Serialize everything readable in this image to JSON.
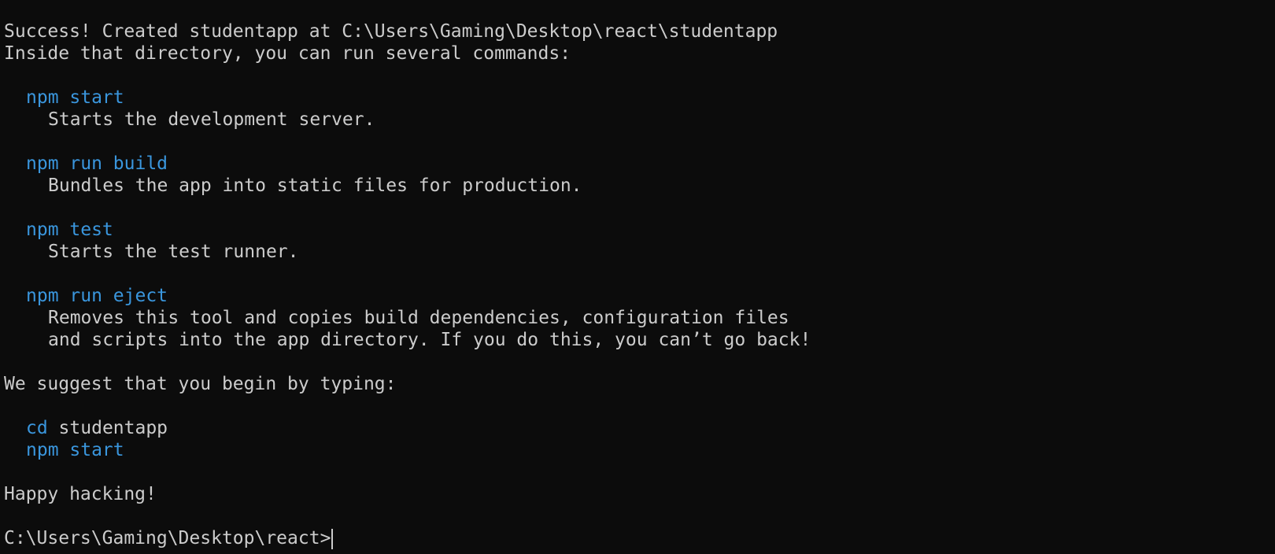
{
  "terminal": {
    "success_line": "Success! Created studentapp at C:\\Users\\Gaming\\Desktop\\react\\studentapp",
    "inside_line": "Inside that directory, you can run several commands:",
    "commands": [
      {
        "command": "npm start",
        "description": [
          "Starts the development server."
        ]
      },
      {
        "command": "npm run build",
        "description": [
          "Bundles the app into static files for production."
        ]
      },
      {
        "command": "npm test",
        "description": [
          "Starts the test runner."
        ]
      },
      {
        "command": "npm run eject",
        "description": [
          "Removes this tool and copies build dependencies, configuration files",
          "and scripts into the app directory. If you do this, you can’t go back!"
        ]
      }
    ],
    "suggest_line": "We suggest that you begin by typing:",
    "cd_keyword": "cd",
    "cd_arg": " studentapp",
    "start_command": "npm start",
    "happy_line": "Happy hacking!",
    "prompt": "C:\\Users\\Gaming\\Desktop\\react>"
  },
  "colors": {
    "background": "#0c0c0c",
    "text": "#cccccc",
    "command": "#3a96dd"
  }
}
